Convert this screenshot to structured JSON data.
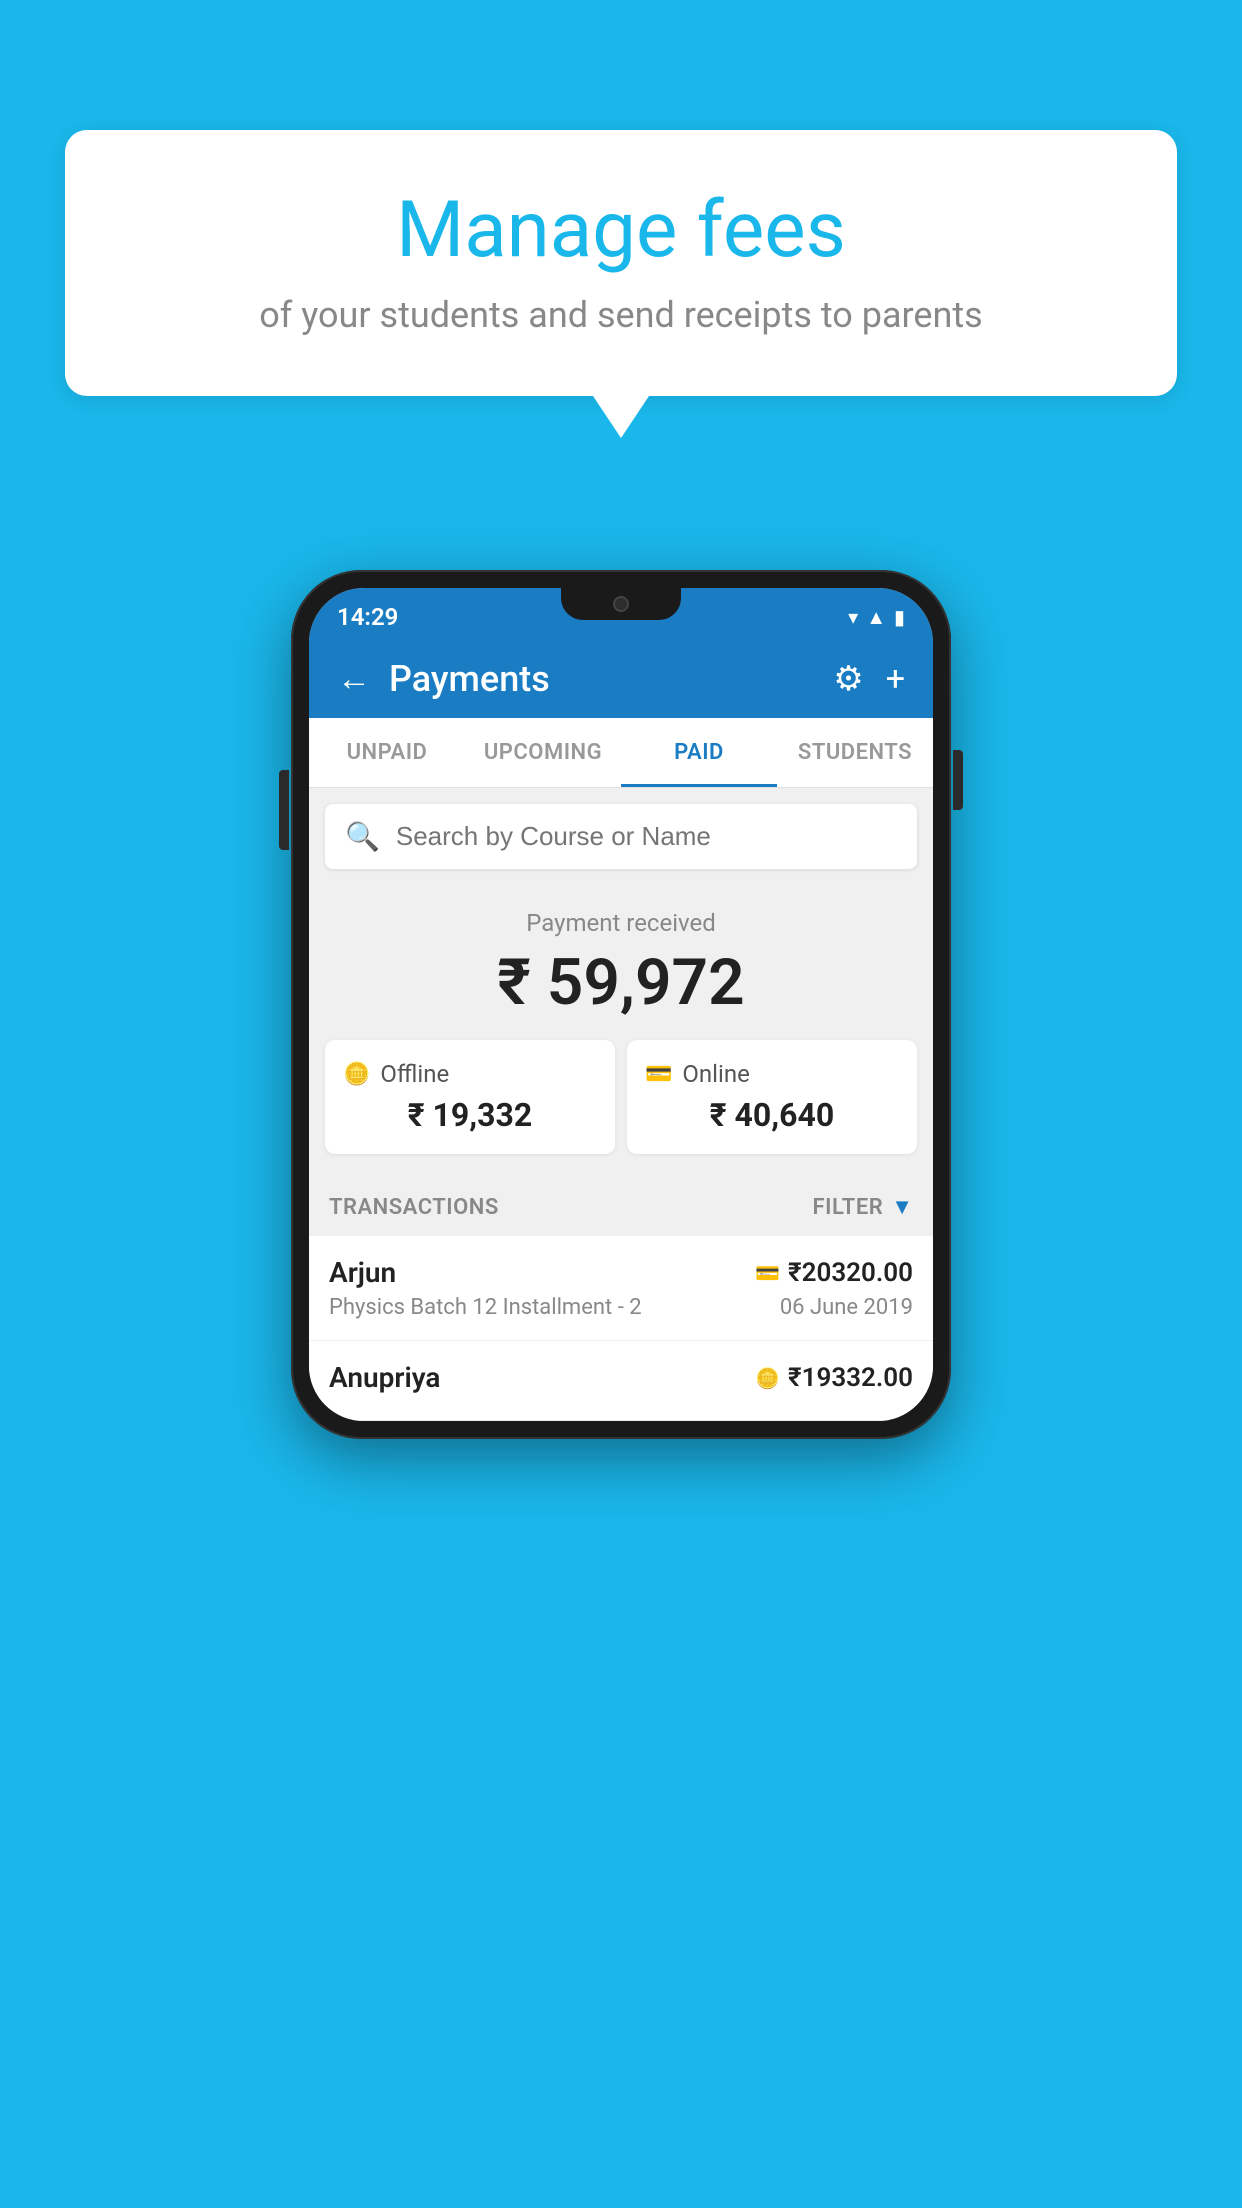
{
  "background_color": "#1ab7ea",
  "speech_bubble": {
    "title": "Manage fees",
    "subtitle": "of your students and send receipts to parents"
  },
  "status_bar": {
    "time": "14:29"
  },
  "app_header": {
    "title": "Payments",
    "back_label": "←",
    "gear_label": "⚙",
    "plus_label": "+"
  },
  "tabs": [
    {
      "label": "UNPAID",
      "active": false
    },
    {
      "label": "UPCOMING",
      "active": false
    },
    {
      "label": "PAID",
      "active": true
    },
    {
      "label": "STUDENTS",
      "active": false
    }
  ],
  "search": {
    "placeholder": "Search by Course or Name"
  },
  "payment_summary": {
    "received_label": "Payment received",
    "total_amount": "₹ 59,972",
    "offline_label": "Offline",
    "offline_amount": "₹ 19,332",
    "online_label": "Online",
    "online_amount": "₹ 40,640"
  },
  "transactions_header": {
    "label": "TRANSACTIONS",
    "filter_label": "FILTER"
  },
  "transactions": [
    {
      "name": "Arjun",
      "amount": "₹20320.00",
      "course": "Physics Batch 12 Installment - 2",
      "date": "06 June 2019",
      "payment_type": "online"
    },
    {
      "name": "Anupriya",
      "amount": "₹19332.00",
      "course": "",
      "date": "",
      "payment_type": "offline"
    }
  ]
}
